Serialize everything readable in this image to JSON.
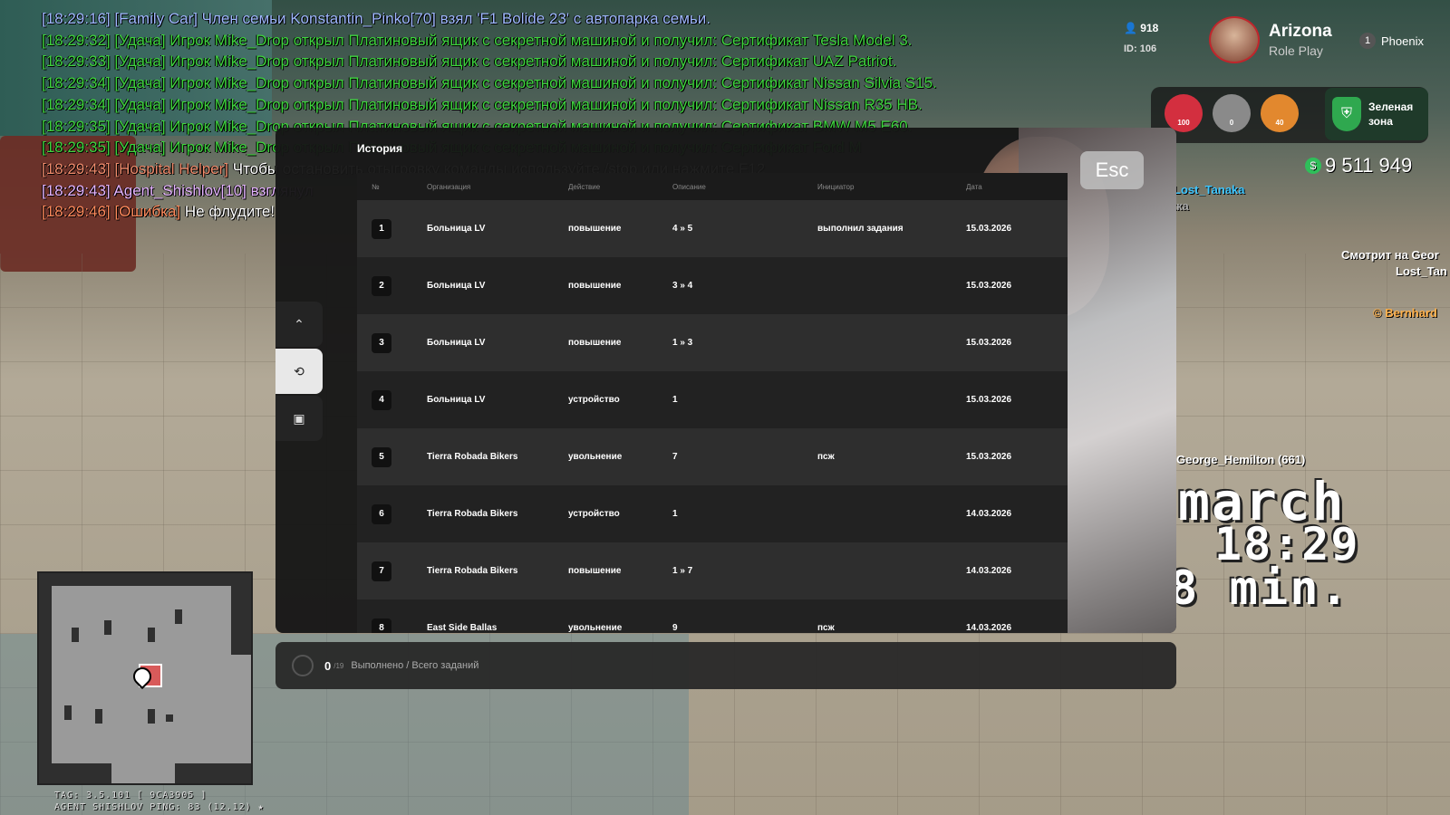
{
  "chat": [
    {
      "ts": "[18:29:16]",
      "parts": [
        {
          "text": " [Family Car] Член семьи Konstantin_Pinko[70] взял 'F1 Bolide 23' с автопарка семьи.",
          "color": "blue"
        }
      ]
    },
    {
      "ts": "[18:29:32]",
      "parts": [
        {
          "text": " [Удача] Игрок Mike_Drop открыл Платиновый ящик с секретной машиной и получил: Сертификат Tesla Model 3.",
          "color": "green"
        }
      ]
    },
    {
      "ts": "[18:29:33]",
      "parts": [
        {
          "text": " [Удача] Игрок Mike_Drop открыл Платиновый ящик с секретной машиной и получил: Сертификат UAZ Patriot.",
          "color": "green"
        }
      ]
    },
    {
      "ts": "[18:29:34]",
      "parts": [
        {
          "text": " [Удача] Игрок Mike_Drop открыл Платиновый ящик с секретной машиной и получил: Сертификат Nissan Silvia S15.",
          "color": "green"
        }
      ]
    },
    {
      "ts": "[18:29:34]",
      "parts": [
        {
          "text": " [Удача] Игрок Mike_Drop открыл Платиновый ящик с секретной машиной и получил: Сертификат Nissan R35 HB.",
          "color": "green"
        }
      ]
    },
    {
      "ts": "[18:29:35]",
      "parts": [
        {
          "text": " [Удача] Игрок Mike_Drop открыл Платиновый ящик с секретной машиной и получил: Сертификат BMW M5 E60.",
          "color": "green"
        }
      ]
    },
    {
      "ts": "[18:29:35]",
      "parts": [
        {
          "text": " [Удача] Игрок Mike_Drop открыл Платиновый ящик с секретной машиной и получил: Сертификат Ford M",
          "color": "green"
        }
      ]
    },
    {
      "ts": "[18:29:43]",
      "parts": [
        {
          "text": " [Hospital Helper]",
          "color": "orange"
        },
        {
          "text": " Чтобы остановить отыгровку команды используйте /stop или нажмите F12",
          "color": "white"
        }
      ]
    },
    {
      "ts": "[18:29:43]",
      "parts": [
        {
          "text": " Agent_Shishlov[10] взглянул",
          "color": "violet"
        }
      ]
    },
    {
      "ts": "[18:29:46]",
      "parts": [
        {
          "text": " [Ошибка]",
          "color": "red"
        },
        {
          "text": " Не флудите!",
          "color": "white"
        }
      ]
    }
  ],
  "hud": {
    "online": "918",
    "id": "ID: 106",
    "logo_title": "Arizona",
    "logo_sub": "Role Play",
    "server_num": "1",
    "server_name": "Phoenix",
    "stats": [
      {
        "icon": "heart-icon",
        "value": "100",
        "color": "#d32f3f"
      },
      {
        "icon": "armor-icon",
        "value": "0",
        "color": "#8a8a8a"
      },
      {
        "icon": "food-icon",
        "value": "40",
        "color": "#e2882e"
      }
    ],
    "zone_line1": "Зеленая",
    "zone_line2": "зона",
    "money": "9 511 949"
  },
  "name_tags": {
    "tanaka": "Lost_Tanaka",
    "tanaka_sub": "Моя подружка",
    "watching": "Смотрит на Geor",
    "lost_tan": "Lost_Tan",
    "bernhard": "© Bernhard",
    "george": "George_Hemilton (661)"
  },
  "big_text": {
    "line1": "march",
    "line2": "18:29",
    "line3": "8 min."
  },
  "footer": {
    "line1": "TAG: 3.5.101 [ 9CA3905 ]",
    "line2": "AGENT SHISHLOV   PING: 83 (12.12) ★"
  },
  "modal": {
    "title": "История",
    "esc": "Esc",
    "columns": [
      "№",
      "Организация",
      "Действие",
      "Описание",
      "Инициатор",
      "Дата"
    ],
    "rows": [
      {
        "n": "1",
        "org": "Больница LV",
        "action": "повышение",
        "desc": "4 » 5",
        "initiator": "выполнил задания",
        "date": "15.03.2026"
      },
      {
        "n": "2",
        "org": "Больница LV",
        "action": "повышение",
        "desc": "3 » 4",
        "initiator": "",
        "date": "15.03.2026"
      },
      {
        "n": "3",
        "org": "Больница LV",
        "action": "повышение",
        "desc": "1 » 3",
        "initiator": "",
        "date": "15.03.2026"
      },
      {
        "n": "4",
        "org": "Больница LV",
        "action": "устройство",
        "desc": "1",
        "initiator": "",
        "date": "15.03.2026"
      },
      {
        "n": "5",
        "org": "Tierra Robada Bikers",
        "action": "увольнение",
        "desc": "7",
        "initiator": "псж",
        "date": "15.03.2026"
      },
      {
        "n": "6",
        "org": "Tierra Robada Bikers",
        "action": "устройство",
        "desc": "1",
        "initiator": "",
        "date": "14.03.2026"
      },
      {
        "n": "7",
        "org": "Tierra Robada Bikers",
        "action": "повышение",
        "desc": "1 » 7",
        "initiator": "",
        "date": "14.03.2026"
      },
      {
        "n": "8",
        "org": "East Side Ballas",
        "action": "увольнение",
        "desc": "9",
        "initiator": "псж",
        "date": "14.03.2026"
      }
    ],
    "nav": [
      {
        "icon": "double-chevron-up-icon",
        "glyph": "⌃",
        "active": false
      },
      {
        "icon": "history-icon",
        "glyph": "⟲",
        "active": true
      },
      {
        "icon": "save-icon",
        "glyph": "▣",
        "active": false
      }
    ]
  },
  "progress": {
    "done": "0",
    "total": "/19",
    "label": "Выполнено / Всего заданий"
  }
}
